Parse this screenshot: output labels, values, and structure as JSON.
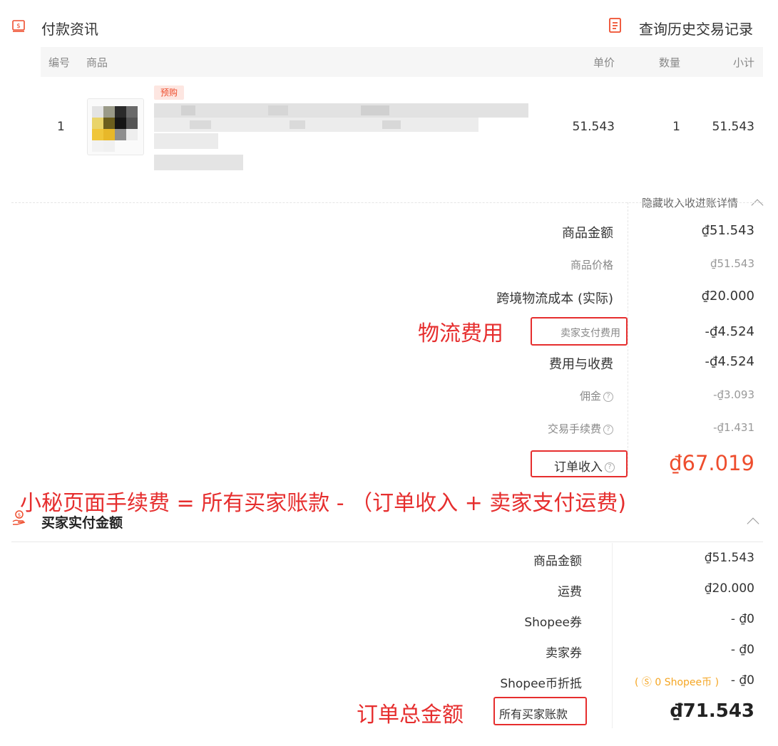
{
  "payment_section": {
    "icon": "receipt-icon",
    "title": "付款资讯",
    "history_icon": "document-list-icon",
    "history_link": "查询历史交易记录"
  },
  "table": {
    "headers": [
      "编号",
      "商品",
      "单价",
      "数量",
      "小计"
    ],
    "rows": [
      {
        "index": "1",
        "badge": "预购",
        "unit_price": "51.543",
        "quantity": "1",
        "subtotal": "51.543"
      }
    ]
  },
  "income": {
    "toggle_label": "隐藏收入收进账详情",
    "product_amount_label": "商品金额",
    "product_amount_value": "₫51.543",
    "product_price_label": "商品价格",
    "product_price_value": "₫51.543",
    "shipping_cost_label": "跨境物流成本 (实际)",
    "shipping_cost_value": "₫20.000",
    "seller_shipping_label": "卖家支付费用",
    "seller_shipping_value": "-₫4.524",
    "fees_label": "费用与收费",
    "fees_value": "-₫4.524",
    "commission_label": "佣金",
    "commission_value": "-₫3.093",
    "transaction_fee_label": "交易手续费",
    "transaction_fee_value": "-₫1.431",
    "order_income_label": "订单收入",
    "order_income_value": "₫67.019"
  },
  "buyer_section": {
    "icon": "money-hand-icon",
    "title": "买家实付金额",
    "product_amount_label": "商品金额",
    "product_amount_value": "₫51.543",
    "shipping_label": "运费",
    "shipping_value": "₫20.000",
    "shopee_voucher_label": "Shopee券",
    "shopee_voucher_value": "- ₫0",
    "seller_voucher_label": "卖家券",
    "seller_voucher_value": "- ₫0",
    "coins_label": "Shopee币折抵",
    "coins_note": "( Ⓢ 0 Shopee币 )",
    "coins_value": "- ₫0",
    "total_label": "所有买家账款",
    "total_value": "₫71.543"
  },
  "annotations": {
    "logistics_fee": "物流费用",
    "formula": "小秘页面手续费 = 所有买家账款 - （订单收入 + 卖家支付运费)",
    "order_total": "订单总金额"
  },
  "colors": {
    "accent": "#ee4d2d",
    "annotation_red": "#e62e2e",
    "coin_orange": "#f5a623"
  }
}
